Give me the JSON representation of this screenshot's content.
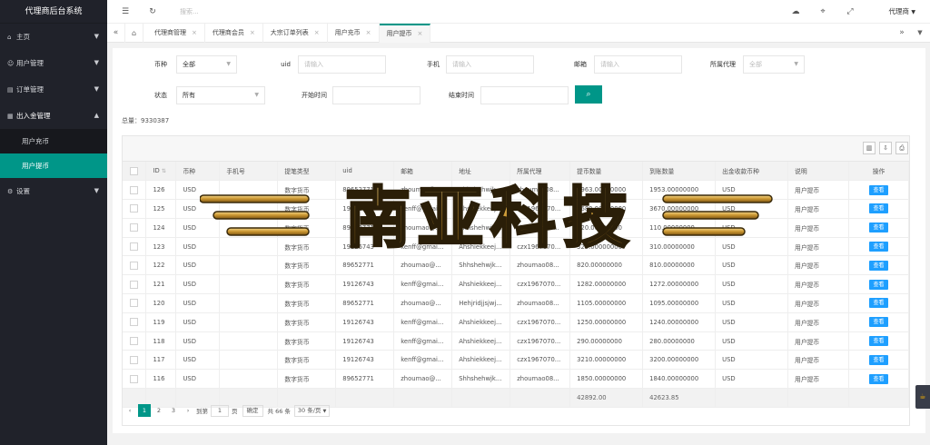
{
  "app": {
    "title": "代理商后台系统"
  },
  "sidebar": {
    "items": [
      {
        "label": "主页",
        "icon": "home-icon"
      },
      {
        "label": "用户管理",
        "icon": "user-icon"
      },
      {
        "label": "订单管理",
        "icon": "order-icon"
      },
      {
        "label": "出入金管理",
        "icon": "money-icon"
      },
      {
        "label": "设置",
        "icon": "gear-icon"
      }
    ],
    "sub_items": [
      {
        "label": "用户充币"
      },
      {
        "label": "用户提币"
      }
    ]
  },
  "topbar": {
    "search_placeholder": "搜索...",
    "user_label": "代理商",
    "icons": [
      "menu-toggle-icon",
      "refresh-icon",
      "theme-icon",
      "tag-icon",
      "fullscreen-icon"
    ]
  },
  "tabs": [
    {
      "label": "代理商管理"
    },
    {
      "label": "代理商会员"
    },
    {
      "label": "大宗订单列表"
    },
    {
      "label": "用户充币"
    },
    {
      "label": "用户提币"
    }
  ],
  "filters": {
    "currency": {
      "label": "币种",
      "value": "全部"
    },
    "uid": {
      "label": "uid",
      "placeholder": "请输入"
    },
    "phone": {
      "label": "手机",
      "placeholder": "请输入"
    },
    "email": {
      "label": "邮箱",
      "placeholder": "请输入"
    },
    "agent": {
      "label": "所属代理",
      "value": "全部"
    },
    "status": {
      "label": "状态",
      "value": "所有"
    },
    "start_time": {
      "label": "开始时间"
    },
    "end_time": {
      "label": "结束时间"
    }
  },
  "total": "总量：9330387",
  "table": {
    "headers": [
      "ID",
      "币种",
      "手机号",
      "提笔类型",
      "uid",
      "邮箱",
      "地址",
      "所属代理",
      "提币数量",
      "到账数量",
      "出金收款币种",
      "说明",
      "操作"
    ],
    "rows": [
      [
        "126",
        "USD",
        "",
        "数字货币",
        "89652771",
        "zhoumao@...",
        "Shhshehwjk...",
        "zhoumao08...",
        "1963.00000000",
        "1953.00000000",
        "USD",
        "用户提币"
      ],
      [
        "125",
        "USD",
        "",
        "数字货币",
        "19126743",
        "kenff@gmai...",
        "Ahshiekkeej...",
        "czx1967070...",
        "3680.00000000",
        "3670.00000000",
        "USD",
        "用户提币"
      ],
      [
        "124",
        "USD",
        "",
        "数字货币",
        "89652771",
        "zhoumao@...",
        "Shhshehwjk...",
        "zhoumao08...",
        "120.00000000",
        "110.00000000",
        "USD",
        "用户提币"
      ],
      [
        "123",
        "USD",
        "",
        "数字货币",
        "19126743",
        "kenff@gmai...",
        "Ahshiekkeej...",
        "czx1967070...",
        "320.00000000",
        "310.00000000",
        "USD",
        "用户提币"
      ],
      [
        "122",
        "USD",
        "",
        "数字货币",
        "89652771",
        "zhoumao@...",
        "Shhshehwjk...",
        "zhoumao08...",
        "820.00000000",
        "810.00000000",
        "USD",
        "用户提币"
      ],
      [
        "121",
        "USD",
        "",
        "数字货币",
        "19126743",
        "kenff@gmai...",
        "Ahshiekkeej...",
        "czx1967070...",
        "1282.00000000",
        "1272.00000000",
        "USD",
        "用户提币"
      ],
      [
        "120",
        "USD",
        "",
        "数字货币",
        "89652771",
        "zhoumao@...",
        "Hehjridjjsjwj...",
        "zhoumao08...",
        "1105.00000000",
        "1095.00000000",
        "USD",
        "用户提币"
      ],
      [
        "119",
        "USD",
        "",
        "数字货币",
        "19126743",
        "kenff@gmai...",
        "Ahshiekkeej...",
        "czx1967070...",
        "1250.00000000",
        "1240.00000000",
        "USD",
        "用户提币"
      ],
      [
        "118",
        "USD",
        "",
        "数字货币",
        "19126743",
        "kenff@gmai...",
        "Ahshiekkeej...",
        "czx1967070...",
        "290.00000000",
        "280.00000000",
        "USD",
        "用户提币"
      ],
      [
        "117",
        "USD",
        "",
        "数字货币",
        "19126743",
        "kenff@gmai...",
        "Ahshiekkeej...",
        "czx1967070...",
        "3210.00000000",
        "3200.00000000",
        "USD",
        "用户提币"
      ],
      [
        "116",
        "USD",
        "",
        "数字货币",
        "89652771",
        "zhoumao@...",
        "Shhshehwjk...",
        "zhoumao08...",
        "1850.00000000",
        "1840.00000000",
        "USD",
        "用户提币"
      ]
    ],
    "view_label": "查看",
    "totals": {
      "amount": "42892.00",
      "received": "42623.85"
    }
  },
  "pager": {
    "prev": "‹",
    "pages": [
      "1",
      "2",
      "3"
    ],
    "next": "›",
    "goto_label": "到第",
    "current_page": "1",
    "page_unit": "页",
    "confirm": "确定",
    "total_label": "共 66 条",
    "per_page": "30 条/页"
  },
  "watermark": {
    "text": "南亚科技"
  },
  "colors": {
    "accent": "#009688",
    "sidebar": "#20222a",
    "view_button": "#1e9fff"
  }
}
